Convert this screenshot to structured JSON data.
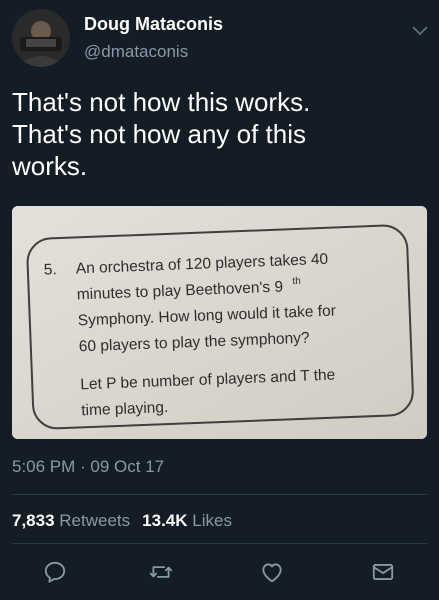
{
  "author": {
    "name": "Doug Mataconis",
    "handle": "@dmataconis"
  },
  "tweet": {
    "lines": [
      "That's not how this works.",
      "That's not how any of this",
      "works."
    ]
  },
  "photo": {
    "question_number": "5.",
    "question_lines": [
      "An orchestra of 120 players takes 40",
      "minutes to play Beethoven's 9",
      "Symphony. How long would it take for",
      "60 players to play the symphony?"
    ],
    "superscript": "th",
    "note_lines": [
      "Let P be number of players and T the",
      "time playing."
    ]
  },
  "meta": {
    "time": "5:06 PM",
    "separator": " · ",
    "date": "09 Oct 17"
  },
  "stats": {
    "retweets_count": "7,833",
    "retweets_label": "Retweets",
    "likes_count": "13.4K",
    "likes_label": "Likes"
  },
  "icons": {
    "reply": "reply-icon",
    "retweet": "retweet-icon",
    "like": "heart-icon",
    "dm": "envelope-icon",
    "menu": "chevron-down-icon"
  },
  "colors": {
    "background": "#141d26",
    "secondary_text": "#8899a6",
    "divider": "#2c3a47"
  }
}
